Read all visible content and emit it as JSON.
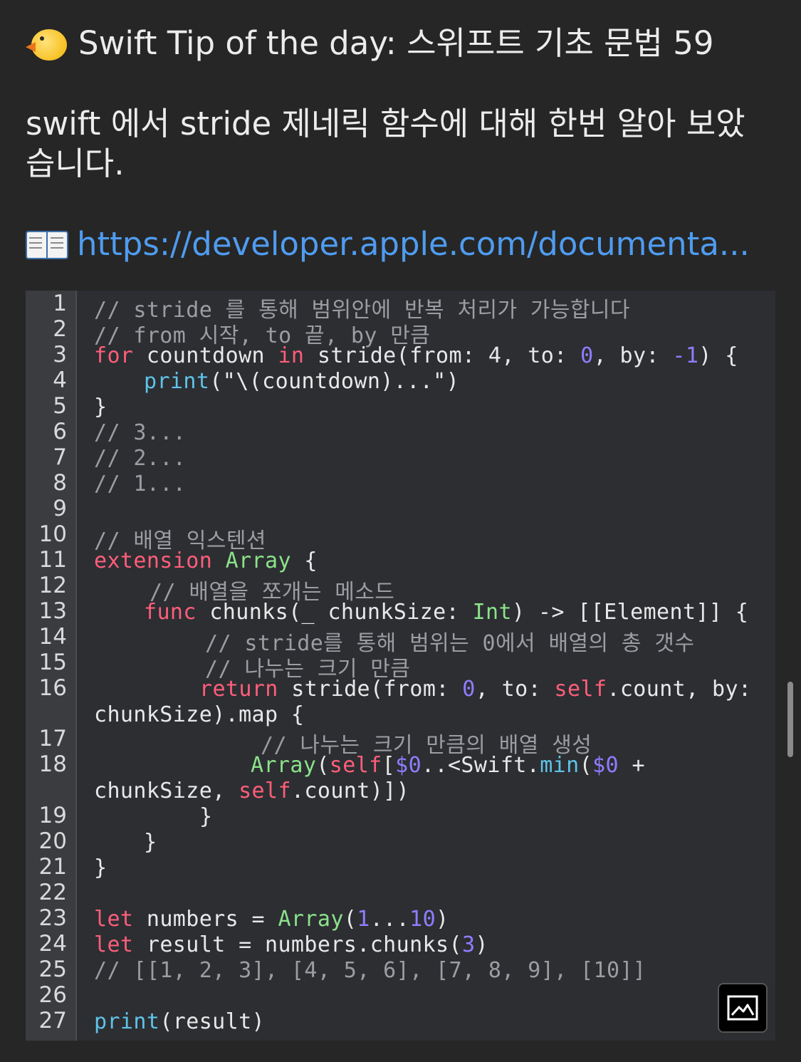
{
  "post": {
    "title": "Swift Tip of the day: 스위프트 기초 문법 59",
    "title_icon": "chick-emoji",
    "description": "swift  에서 stride 제네릭 함수에 대해 한번 알아 보았습니다.",
    "link_icon": "open-book-emoji",
    "link_text": "https://developer.apple.com/documenta..."
  },
  "code": {
    "line_numbers": [
      "1",
      "2",
      "3",
      "4",
      "5",
      "6",
      "7",
      "8",
      "9",
      "10",
      "11",
      "12",
      "13",
      "14",
      "15",
      "16",
      "17",
      "18",
      "19",
      "20",
      "21",
      "22",
      "23",
      "24",
      "25",
      "26",
      "27"
    ],
    "lines": [
      "// stride 를 통해 범위안에 반복 처리가 가능합니다",
      "// from 시작, to 끝, by 만큼",
      "for countdown in stride(from: 4, to: 0, by: -1) {",
      "    print(\"\\(countdown)...\")",
      "}",
      "// 3...",
      "// 2...",
      "// 1...",
      "",
      "// 배열 익스텐션",
      "extension Array {",
      "    // 배열을 쪼개는 메소드",
      "    func chunks(_ chunkSize: Int) -> [[Element]] {",
      "        // stride를 통해 범위는 0에서 배열의 총 갯수",
      "        // 나누는 크기 만큼",
      "        return stride(from: 0, to: self.count, by:",
      "chunkSize).map {",
      "            // 나누는 크기 만큼의 배열 생성",
      "            Array(self[$0..<Swift.min($0 +",
      "chunkSize, self.count)])",
      "        }",
      "    }",
      "}",
      "",
      "let numbers = Array(1...10)",
      "let result = numbers.chunks(3)",
      "// [[1, 2, 3], [4, 5, 6], [7, 8, 9], [10]]",
      "",
      "print(result)"
    ]
  },
  "colors": {
    "background": "#262626",
    "link": "#4f9cf0",
    "code_bg": "#2c2e32",
    "keyword": "#ff5e7a",
    "type": "#8be28a",
    "number": "#8f7dff",
    "function": "#5fc3e8",
    "comment": "#9b9da2"
  },
  "badge_icon": "image-icon"
}
